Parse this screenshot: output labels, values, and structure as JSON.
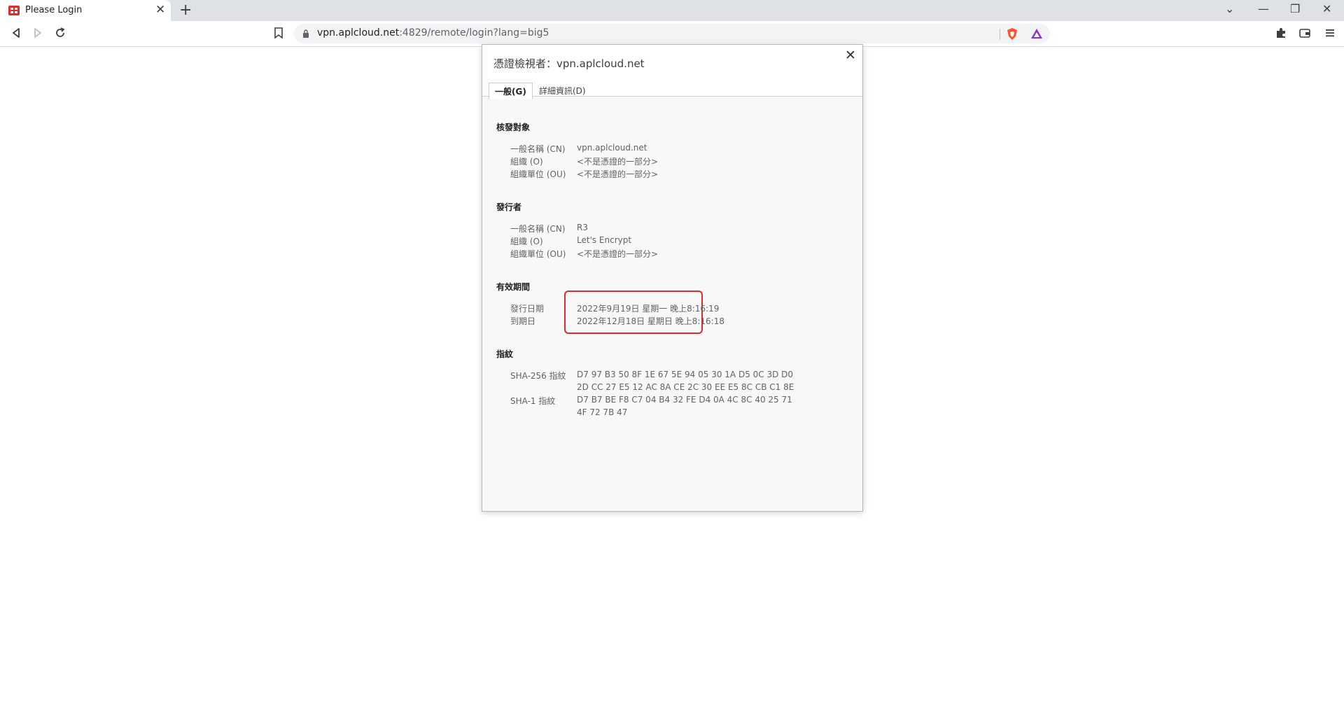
{
  "browser": {
    "tab_title": "Please Login",
    "tab_close": "✕",
    "new_tab": "+",
    "window_controls": {
      "tab_search": "⌄",
      "minimize": "—",
      "restore": "❐",
      "close": "✕"
    },
    "url_host": "vpn.aplcloud.net",
    "url_rest": ":4829/remote/login?lang=big5",
    "accent": "#e12a2a"
  },
  "dialog": {
    "title": "憑證檢視者：vpn.aplcloud.net",
    "close": "✕",
    "tabs": [
      "一般(G)",
      "詳細資訊(D)"
    ],
    "subject": {
      "heading": "核發對象",
      "rows": [
        {
          "label": "一般名稱 (CN)",
          "value": "vpn.aplcloud.net"
        },
        {
          "label": "組織 (O)",
          "value": "<不是憑證的一部分>"
        },
        {
          "label": "組織單位 (OU)",
          "value": "<不是憑證的一部分>"
        }
      ]
    },
    "issuer": {
      "heading": "發行者",
      "rows": [
        {
          "label": "一般名稱 (CN)",
          "value": "R3"
        },
        {
          "label": "組織 (O)",
          "value": "Let's Encrypt"
        },
        {
          "label": "組織單位 (OU)",
          "value": "<不是憑證的一部分>"
        }
      ]
    },
    "validity": {
      "heading": "有效期間",
      "rows": [
        {
          "label": "發行日期",
          "value": "2022年9月19日 星期一 晚上8:16:19"
        },
        {
          "label": "到期日",
          "value": "2022年12月18日 星期日 晚上8:16:18"
        }
      ]
    },
    "fingerprints": {
      "heading": "指紋",
      "sha256_label": "SHA-256 指紋",
      "sha256_line1": "D7 97 B3 50 8F 1E 67 5E 94 05 30 1A D5 0C 3D D0",
      "sha256_line2": "2D CC 27 E5 12 AC 8A CE 2C 30 EE E5 8C CB C1 8E",
      "sha1_label": "SHA-1 指紋",
      "sha1_line1": "D7 B7 BE F8 C7 04 B4 32 FE D4 0A 4C 8C 40 25 71",
      "sha1_line2": "4F 72 7B 47"
    }
  }
}
